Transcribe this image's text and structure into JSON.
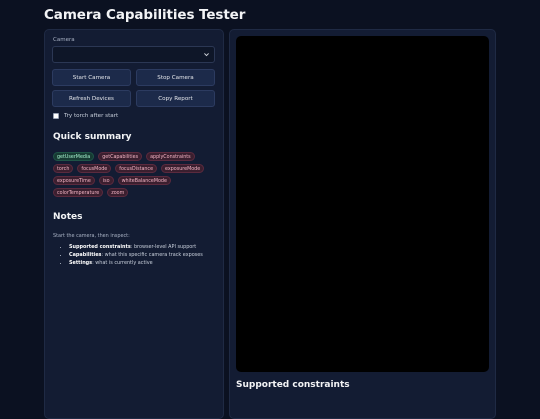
{
  "page": {
    "title": "Camera Capabilities Tester"
  },
  "camera": {
    "label": "Camera",
    "selected": ""
  },
  "buttons": {
    "start": "Start Camera",
    "stop": "Stop Camera",
    "refresh": "Refresh Devices",
    "copy": "Copy Report"
  },
  "torch": {
    "label": "Try torch after start",
    "checked": false
  },
  "summary": {
    "heading": "Quick summary",
    "chips": [
      {
        "label": "getUserMedia",
        "status": "supported"
      },
      {
        "label": "getCapabilities",
        "status": "unsupported"
      },
      {
        "label": "applyConstraints",
        "status": "unsupported"
      },
      {
        "label": "torch",
        "status": "unsupported"
      },
      {
        "label": "focusMode",
        "status": "unsupported"
      },
      {
        "label": "focusDistance",
        "status": "unsupported"
      },
      {
        "label": "exposureMode",
        "status": "unsupported"
      },
      {
        "label": "exposureTime",
        "status": "unsupported"
      },
      {
        "label": "iso",
        "status": "unsupported"
      },
      {
        "label": "whiteBalanceMode",
        "status": "unsupported"
      },
      {
        "label": "colorTemperature",
        "status": "unsupported"
      },
      {
        "label": "zoom",
        "status": "unsupported"
      }
    ],
    "colors": {
      "supported": "#173b33",
      "unsupported": "#3b1f2f"
    }
  },
  "notes": {
    "heading": "Notes",
    "intro": "Start the camera, then inspect:",
    "items": [
      {
        "term": "Supported constraints",
        "desc": ": browser-level API support"
      },
      {
        "term": "Capabilities",
        "desc": ": what this specific camera track exposes"
      },
      {
        "term": "Settings",
        "desc": ": what is currently active"
      }
    ]
  },
  "right": {
    "section_heading": "Supported constraints"
  },
  "icons": {
    "select_chevron": "chevron-down-icon"
  }
}
